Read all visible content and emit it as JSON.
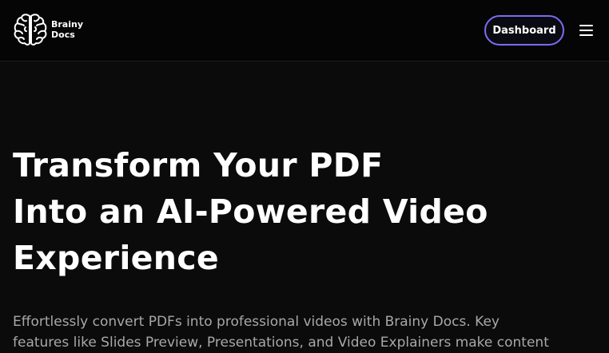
{
  "navbar": {
    "brand": {
      "line1": "Brainy",
      "line2": "Docs",
      "logo_icon": "brain-icon"
    },
    "dashboard_label": "Dashboard",
    "menu_icon": "hamburger-menu-icon",
    "accent_color": "#7b6cf0"
  },
  "hero": {
    "title_lines": [
      "Transform Your PDF",
      "Into an AI-Powered Video",
      "Experience"
    ],
    "subtitle_lines": [
      "Effortlessly convert PDFs into professional videos with Brainy Docs. Key",
      "features like Slides Preview, Presentations, and Video Explainers make content"
    ]
  }
}
